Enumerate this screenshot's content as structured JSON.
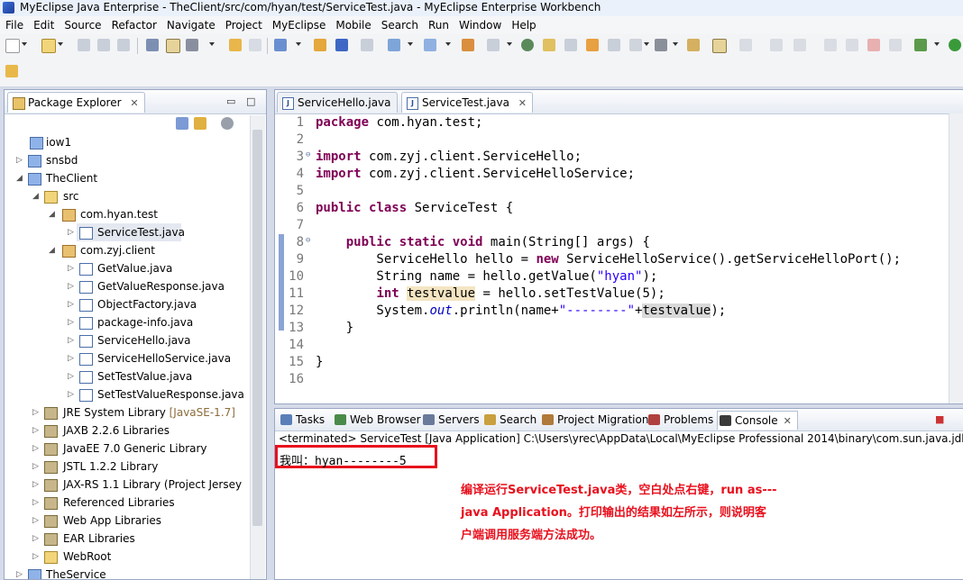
{
  "window": {
    "title": "MyEclipse Java Enterprise - TheClient/src/com/hyan/test/ServiceTest.java - MyEclipse Enterprise Workbench"
  },
  "menu": [
    "File",
    "Edit",
    "Source",
    "Refactor",
    "Navigate",
    "Project",
    "MyEclipse",
    "Mobile",
    "Search",
    "Run",
    "Window",
    "Help"
  ],
  "package_explorer": {
    "title": "Package Explorer",
    "items": [
      {
        "label": "iow1",
        "decoration": ""
      },
      {
        "label": "snsbd",
        "decoration": ""
      },
      {
        "label": "TheClient",
        "decoration": ""
      },
      {
        "label": "src",
        "decoration": ""
      },
      {
        "label": "com.hyan.test",
        "decoration": ""
      },
      {
        "label": "ServiceTest.java",
        "decoration": ""
      },
      {
        "label": "com.zyj.client",
        "decoration": ""
      },
      {
        "label": "GetValue.java",
        "decoration": ""
      },
      {
        "label": "GetValueResponse.java",
        "decoration": ""
      },
      {
        "label": "ObjectFactory.java",
        "decoration": ""
      },
      {
        "label": "package-info.java",
        "decoration": ""
      },
      {
        "label": "ServiceHello.java",
        "decoration": ""
      },
      {
        "label": "ServiceHelloService.java",
        "decoration": ""
      },
      {
        "label": "SetTestValue.java",
        "decoration": ""
      },
      {
        "label": "SetTestValueResponse.java",
        "decoration": ""
      },
      {
        "label": "JRE System Library",
        "decoration": "[JavaSE-1.7]"
      },
      {
        "label": "JAXB 2.2.6 Libraries",
        "decoration": ""
      },
      {
        "label": "JavaEE 7.0 Generic Library",
        "decoration": ""
      },
      {
        "label": "JSTL 1.2.2 Library",
        "decoration": ""
      },
      {
        "label": "JAX-RS 1.1 Library (Project Jersey",
        "decoration": ""
      },
      {
        "label": "Referenced Libraries",
        "decoration": ""
      },
      {
        "label": "Web App Libraries",
        "decoration": ""
      },
      {
        "label": "EAR Libraries",
        "decoration": ""
      },
      {
        "label": "WebRoot",
        "decoration": ""
      },
      {
        "label": "TheService",
        "decoration": ""
      }
    ]
  },
  "editor": {
    "tabs": [
      {
        "label": "ServiceHello.java"
      },
      {
        "label": "ServiceTest.java"
      }
    ],
    "lines": [
      {
        "n": "1",
        "tokens": [
          {
            "t": "package",
            "c": "kw"
          },
          {
            "t": " com.hyan.test;",
            "c": ""
          }
        ]
      },
      {
        "n": "2",
        "tokens": []
      },
      {
        "n": "3",
        "tokens": [
          {
            "t": "import",
            "c": "kw"
          },
          {
            "t": " com.zyj.client.ServiceHello;",
            "c": ""
          }
        ]
      },
      {
        "n": "4",
        "tokens": [
          {
            "t": "import",
            "c": "kw"
          },
          {
            "t": " com.zyj.client.ServiceHelloService;",
            "c": ""
          }
        ]
      },
      {
        "n": "5",
        "tokens": []
      },
      {
        "n": "6",
        "tokens": [
          {
            "t": "public",
            "c": "kw"
          },
          {
            "t": " ",
            "c": ""
          },
          {
            "t": "class",
            "c": "kw"
          },
          {
            "t": " ServiceTest {",
            "c": ""
          }
        ]
      },
      {
        "n": "7",
        "tokens": []
      },
      {
        "n": "8",
        "tokens": [
          {
            "t": "    ",
            "c": ""
          },
          {
            "t": "public",
            "c": "kw"
          },
          {
            "t": " ",
            "c": ""
          },
          {
            "t": "static",
            "c": "kw"
          },
          {
            "t": " ",
            "c": ""
          },
          {
            "t": "void",
            "c": "kw"
          },
          {
            "t": " main(String[] args) {",
            "c": ""
          }
        ]
      },
      {
        "n": "9",
        "tokens": [
          {
            "t": "        ServiceHello hello = ",
            "c": ""
          },
          {
            "t": "new",
            "c": "kw"
          },
          {
            "t": " ServiceHelloService().getServiceHelloPort();",
            "c": ""
          }
        ]
      },
      {
        "n": "10",
        "tokens": [
          {
            "t": "        String name = hello.getValue(",
            "c": ""
          },
          {
            "t": "\"hyan\"",
            "c": "str"
          },
          {
            "t": ");",
            "c": ""
          }
        ]
      },
      {
        "n": "11",
        "tokens": [
          {
            "t": "        ",
            "c": ""
          },
          {
            "t": "int",
            "c": "kw"
          },
          {
            "t": " ",
            "c": ""
          },
          {
            "t": "testvalue",
            "c": "hl1"
          },
          {
            "t": " = hello.setTestValue(5);",
            "c": ""
          }
        ]
      },
      {
        "n": "12",
        "tokens": [
          {
            "t": "        System.",
            "c": ""
          },
          {
            "t": "out",
            "c": "fld"
          },
          {
            "t": ".println(name+",
            "c": ""
          },
          {
            "t": "\"--------\"",
            "c": "str"
          },
          {
            "t": "+",
            "c": ""
          },
          {
            "t": "testvalue",
            "c": "hl2"
          },
          {
            "t": ");",
            "c": ""
          }
        ]
      },
      {
        "n": "13",
        "tokens": [
          {
            "t": "    }",
            "c": ""
          }
        ]
      },
      {
        "n": "14",
        "tokens": []
      },
      {
        "n": "15",
        "tokens": [
          {
            "t": "}",
            "c": ""
          }
        ]
      },
      {
        "n": "16",
        "tokens": []
      }
    ]
  },
  "console": {
    "tabs": [
      {
        "label": "Tasks",
        "icon": "tasks-icon"
      },
      {
        "label": "Web Browser",
        "icon": "globe-icon"
      },
      {
        "label": "Servers",
        "icon": "servers-icon"
      },
      {
        "label": "Search",
        "icon": "search-icon"
      },
      {
        "label": "Project Migration",
        "icon": "migration-icon"
      },
      {
        "label": "Problems",
        "icon": "problems-icon"
      },
      {
        "label": "Console",
        "icon": "console-icon"
      }
    ],
    "status": "<terminated> ServiceTest [Java Application] C:\\Users\\yrec\\AppData\\Local\\MyEclipse Professional 2014\\binary\\com.sun.java.jdk7.wi",
    "output": "我叫：hyan--------5",
    "annotation_lines": [
      "编译运行ServiceTest.java类，空白处点右键，run as---",
      "java Application。打印输出的结果如左所示，则说明客",
      "户端调用服务端方法成功。"
    ]
  },
  "colors": {
    "keyword": "#7f0055",
    "string": "#2a00ff",
    "field": "#0000c0",
    "annotation": "#e8101d"
  }
}
